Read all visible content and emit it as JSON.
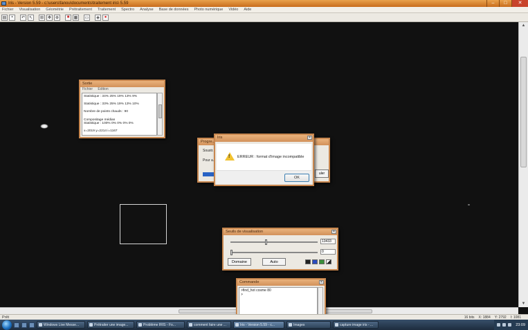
{
  "window": {
    "title": "Iris - Version 5.59 - c:\\users\\fanou\\documents\\traitement iris\\ 5.59"
  },
  "menu": [
    "Fichier",
    "Visualisation",
    "Géométrie",
    "Prétraitement",
    "Traitement",
    "Spectro",
    "Analyse",
    "Base de données",
    "Photo numérique",
    "Vidéo",
    "Aide"
  ],
  "toolbar": [
    "open-icon",
    "save-icon",
    "sep",
    "undo-icon",
    "pointer-icon",
    "sep",
    "grid-icon",
    "move-icon",
    "zoom-icon",
    "sep",
    "palette-icon",
    "table-icon",
    "sep",
    "image-icon",
    "sep",
    "target-icon",
    "stop-icon"
  ],
  "sortie": {
    "title": "Sortie",
    "menu": [
      "Fichier",
      "Edition"
    ],
    "lines": [
      "Statistique : 34% 25% 19% 13% 9%",
      "",
      "Statistique : 33% 25% 19% 13% 10%",
      "",
      "Nombre de points chauds : 90",
      "",
      "Compositage médian",
      "Statistique : 100% 0% 0% 0% 0%",
      "",
      "x=2019  y=2214  i=1167"
    ]
  },
  "progress": {
    "title": "Progre...",
    "line1": "Soustr...",
    "line2": "Pour a...",
    "cancel": "uler"
  },
  "error_dialog": {
    "title": "Iris",
    "message": "ERREUR : format d'image incompatible",
    "ok": "OK"
  },
  "seuils": {
    "title": "Seuils de visualisation",
    "high_value": "13433",
    "low_value": "0",
    "domaine": "Domaine",
    "auto": "Auto",
    "swatches": [
      "#222222",
      "#2b4cc0",
      "#3a8f3a",
      "#ffffff"
    ]
  },
  "commande": {
    "title": "Commande",
    "lines": [
      ">find_hot cosme 80",
      ">"
    ]
  },
  "status": {
    "left": "Prêt",
    "bits": "16 bits",
    "x": "X: 1884",
    "y": "Y: 2792",
    "i": "I: 1081"
  },
  "taskbar": {
    "tasks": [
      "Windows Live Messe...",
      "Prétraiter une image...",
      "Problème IRIS - Fo...",
      "comment faire une ...",
      "Iris - Version 5.59 - c...",
      "Images",
      "capture image iris - ..."
    ],
    "clock": "23:09"
  }
}
